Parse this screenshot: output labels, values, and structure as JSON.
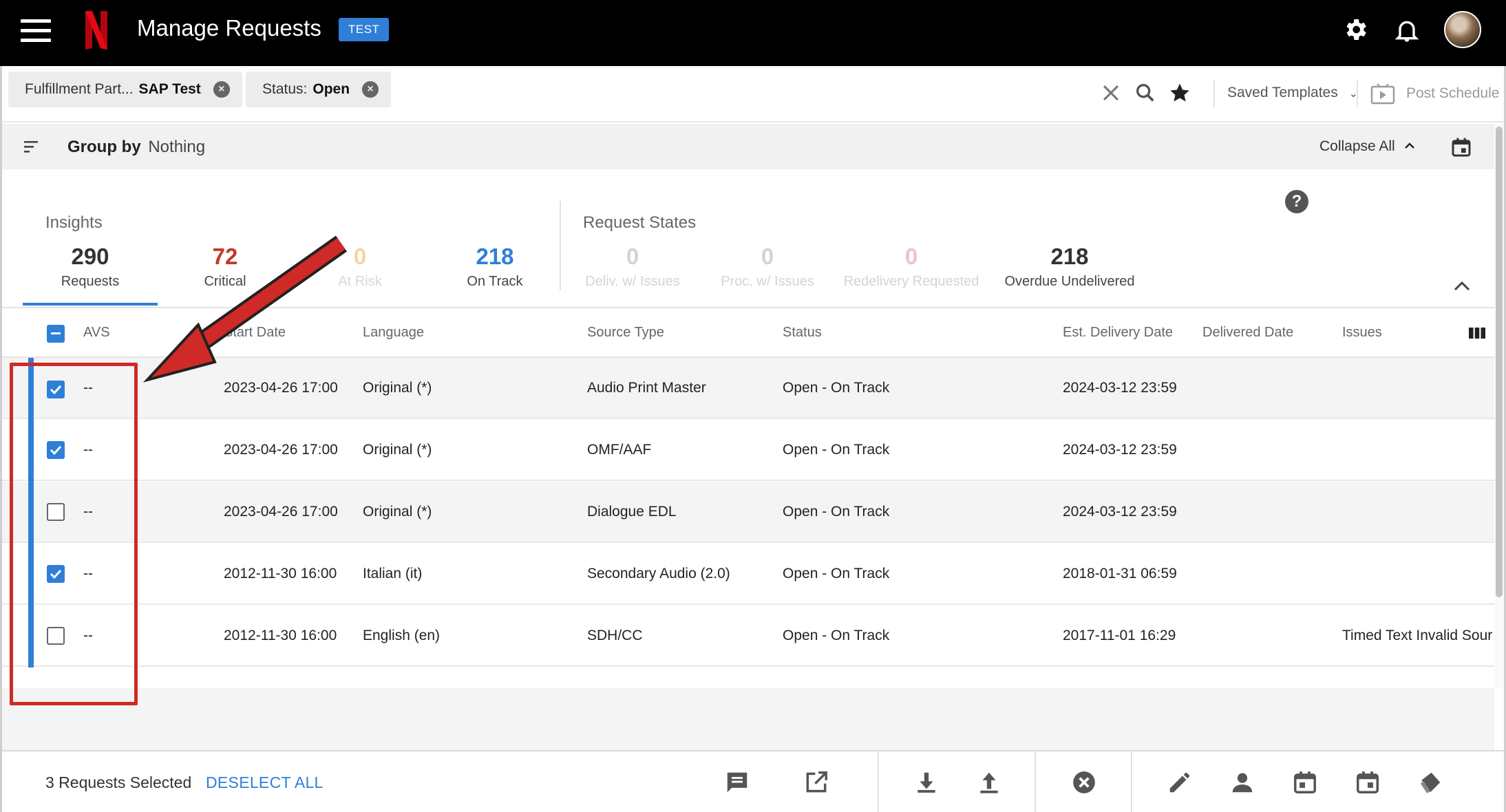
{
  "app": {
    "title": "Manage Requests",
    "env_badge": "TEST"
  },
  "filters": [
    {
      "label": "Fulfillment Part...",
      "value": "SAP Test"
    },
    {
      "label": "Status:",
      "value": "Open"
    }
  ],
  "filter_actions": {
    "saved_templates": "Saved Templates",
    "post_schedule": "Post Schedule"
  },
  "group_bar": {
    "group_by_label": "Group by",
    "group_by_value": "Nothing",
    "collapse_all": "Collapse All"
  },
  "insights": {
    "heading": "Insights",
    "stats": [
      {
        "value": "290",
        "label": "Requests",
        "color": "#333333"
      },
      {
        "value": "72",
        "label": "Critical",
        "color": "#c0392b"
      },
      {
        "value": "0",
        "label": "At Risk",
        "color": "#f3d6a2"
      },
      {
        "value": "218",
        "label": "On Track",
        "color": "#2f7fd8"
      }
    ]
  },
  "request_states": {
    "heading": "Request States",
    "stats": [
      {
        "value": "0",
        "label": "Deliv. w/ Issues",
        "color": "#d4d4d4"
      },
      {
        "value": "0",
        "label": "Proc. w/ Issues",
        "color": "#d4d4d4"
      },
      {
        "value": "0",
        "label": "Redelivery Requested",
        "color": "#efc3c3"
      },
      {
        "value": "218",
        "label": "Overdue Undelivered",
        "color": "#333333"
      }
    ]
  },
  "table": {
    "columns": [
      "AVS",
      "Start Date",
      "Language",
      "Source Type",
      "Status",
      "Est. Delivery Date",
      "Delivered Date",
      "Issues"
    ],
    "rows": [
      {
        "checked": true,
        "avs": "--",
        "start_date": "2023-04-26 17:00",
        "language": "Original (*)",
        "source_type": "Audio Print Master",
        "status": "Open - On Track",
        "est_delivery": "2024-03-12 23:59",
        "delivered": "",
        "issues": ""
      },
      {
        "checked": true,
        "avs": "--",
        "start_date": "2023-04-26 17:00",
        "language": "Original (*)",
        "source_type": "OMF/AAF",
        "status": "Open - On Track",
        "est_delivery": "2024-03-12 23:59",
        "delivered": "",
        "issues": ""
      },
      {
        "checked": false,
        "avs": "--",
        "start_date": "2023-04-26 17:00",
        "language": "Original (*)",
        "source_type": "Dialogue EDL",
        "status": "Open - On Track",
        "est_delivery": "2024-03-12 23:59",
        "delivered": "",
        "issues": ""
      },
      {
        "checked": true,
        "avs": "--",
        "start_date": "2012-11-30 16:00",
        "language": "Italian (it)",
        "source_type": "Secondary Audio (2.0)",
        "status": "Open - On Track",
        "est_delivery": "2018-01-31 06:59",
        "delivered": "",
        "issues": ""
      },
      {
        "checked": false,
        "avs": "--",
        "start_date": "2012-11-30 16:00",
        "language": "English (en)",
        "source_type": "SDH/CC",
        "status": "Open - On Track",
        "est_delivery": "2017-11-01 16:29",
        "delivered": "",
        "issues": "Timed Text Invalid Source"
      }
    ]
  },
  "selection_bar": {
    "count_text": "3 Requests Selected",
    "deselect_all": "DESELECT ALL",
    "icons": [
      "comment-icon",
      "open-external-icon",
      "download-icon",
      "upload-icon",
      "cancel-icon",
      "edit-icon",
      "person-icon",
      "calendar-icon",
      "calendar-icon",
      "tag-icon"
    ]
  },
  "colors": {
    "accent": "#2f7fd8",
    "brand_red": "#e50914",
    "annotation_red": "#cf2a27"
  }
}
